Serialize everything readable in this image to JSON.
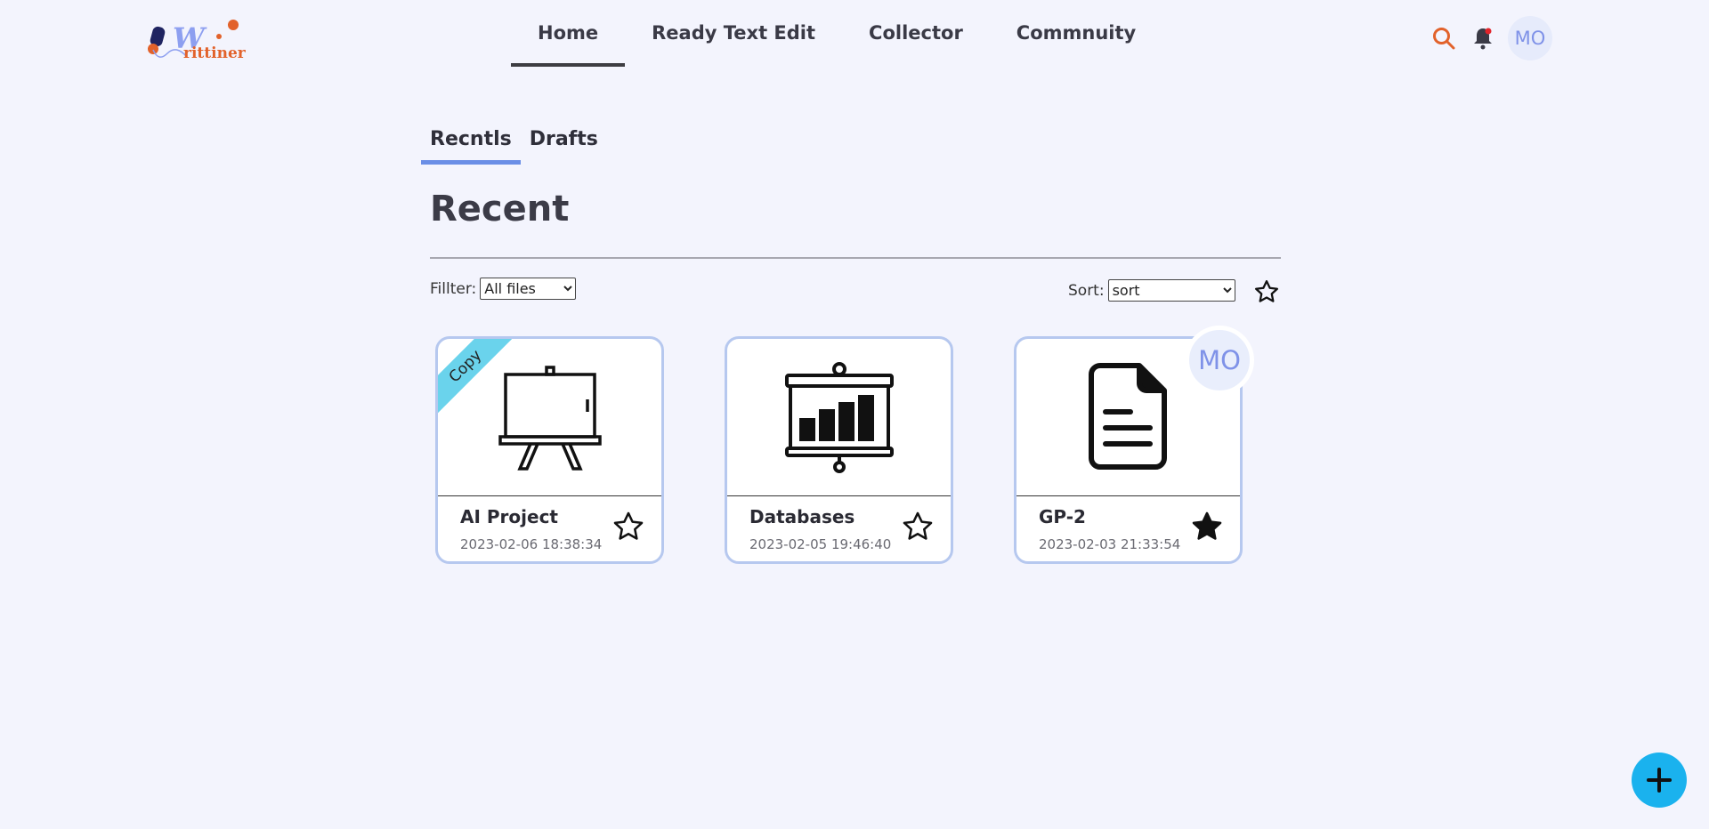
{
  "brand": {
    "logo_w": "W",
    "logo_rest": "rittiner",
    "colors": {
      "primary": "#8d9ff0",
      "accent": "#e2622b"
    }
  },
  "nav": {
    "items": [
      {
        "label": "Home",
        "active": true
      },
      {
        "label": "Ready Text Edit"
      },
      {
        "label": "Collector"
      },
      {
        "label": "Commnuity"
      }
    ]
  },
  "header": {
    "search_icon": "search-icon",
    "bell_icon": "bell-icon",
    "avatar": "MO"
  },
  "tabs": [
    {
      "label": "Recntls",
      "active": true
    },
    {
      "label": "Drafts"
    }
  ],
  "page": {
    "title": "Recent"
  },
  "filter": {
    "label": "Fillter:",
    "selected": "All files"
  },
  "sort": {
    "label": "Sort:",
    "selected": "sort"
  },
  "cards": [
    {
      "title": "AI Project",
      "date": "2023-02-06 18:38:34",
      "ribbon": "Copy",
      "icon": "easel-icon",
      "starred": false
    },
    {
      "title": "Databases",
      "date": "2023-02-05 19:46:40",
      "icon": "presentation-chart-icon",
      "starred": false
    },
    {
      "title": "GP-2",
      "date": "2023-02-03 21:33:54",
      "icon": "document-icon",
      "starred": true,
      "owner_avatar": "MO"
    }
  ],
  "fab": {
    "icon": "plus-icon",
    "color": "#1ab2ee"
  }
}
